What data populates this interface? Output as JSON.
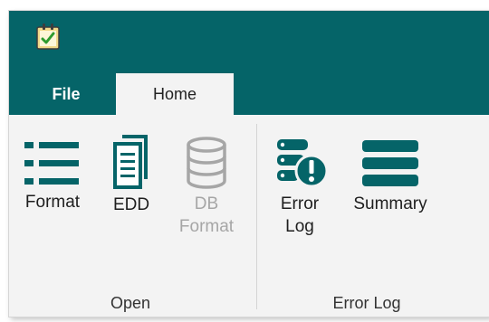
{
  "tabs": [
    {
      "label": "File"
    },
    {
      "label": "Home"
    }
  ],
  "groups": {
    "open": {
      "label": "Open",
      "buttons": {
        "format": {
          "label": "Format"
        },
        "edd": {
          "label": "EDD"
        },
        "db_format": {
          "line1": "DB",
          "line2": "Format",
          "state": "disabled"
        }
      }
    },
    "error_log": {
      "label": "Error Log",
      "buttons": {
        "error_log": {
          "line1": "Error",
          "line2": "Log"
        },
        "summary": {
          "label": "Summary"
        }
      }
    }
  },
  "colors": {
    "accent": "#056468",
    "ribbon_bg": "#f3f3f3",
    "disabled": "#a6a6a6"
  }
}
